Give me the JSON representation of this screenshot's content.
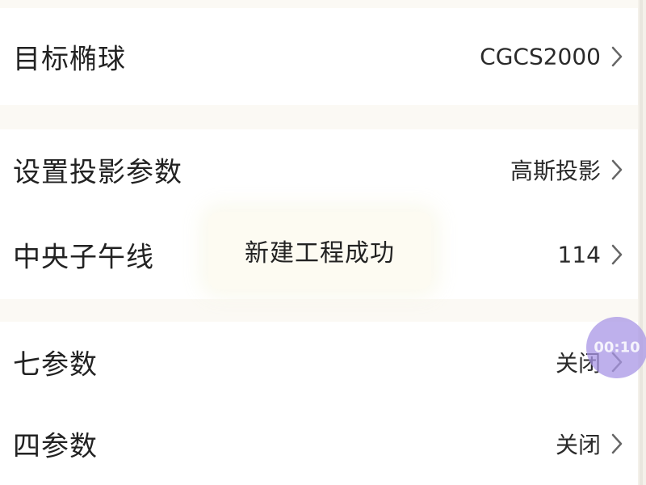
{
  "settings": {
    "rows": [
      {
        "label": "目标椭球",
        "value": "CGCS2000"
      },
      {
        "label": "设置投影参数",
        "value": "高斯投影"
      },
      {
        "label": "中央子午线",
        "value": "114"
      },
      {
        "label": "七参数",
        "value": "关闭"
      },
      {
        "label": "四参数",
        "value": "关闭"
      }
    ]
  },
  "toast": {
    "message": "新建工程成功"
  },
  "overlay": {
    "timer": "00:10",
    "color": "#a896e6"
  },
  "icons": {
    "row_arrow": "chevron-right-icon"
  }
}
